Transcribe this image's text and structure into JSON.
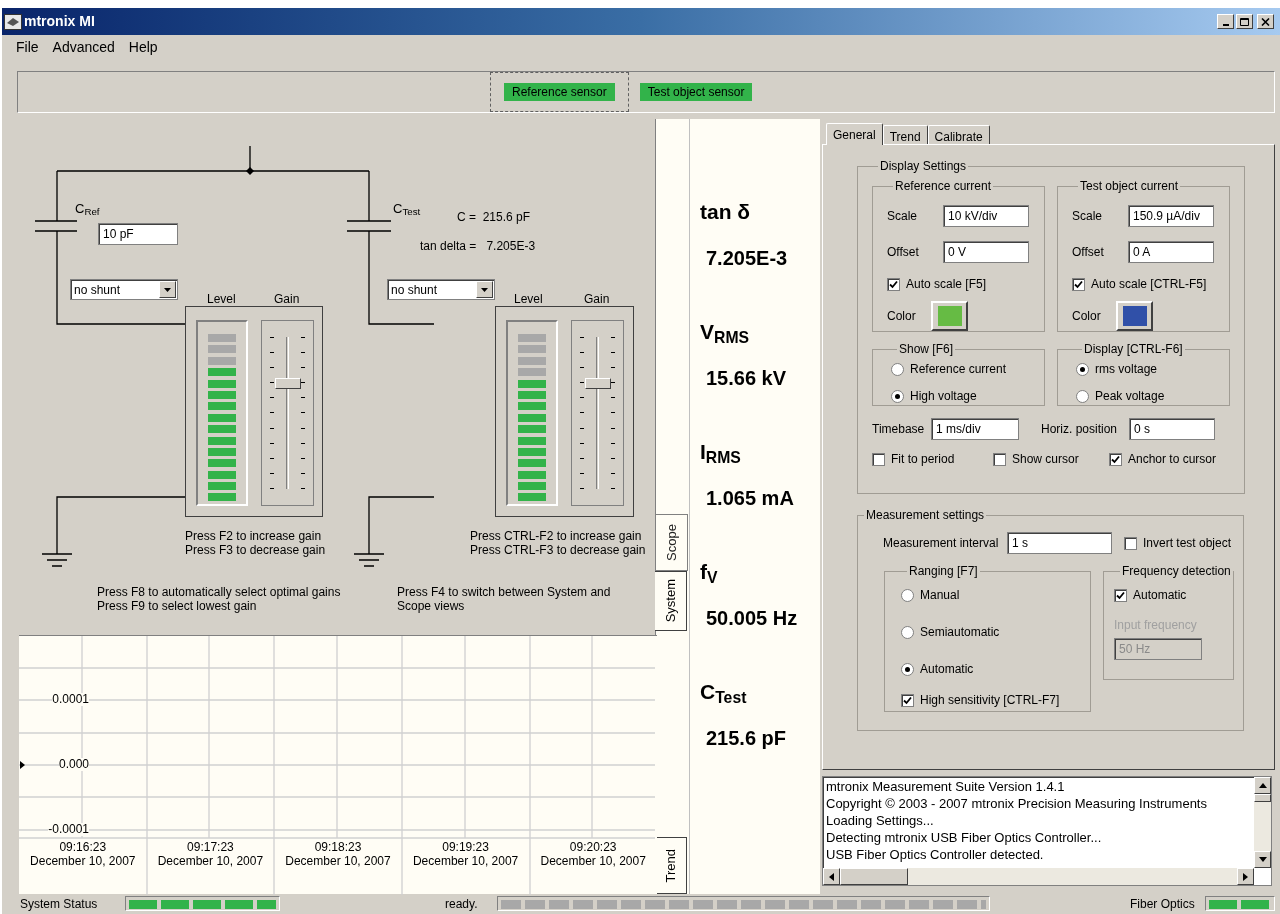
{
  "window": {
    "title": "mtronix MI"
  },
  "menu": [
    {
      "label": "File"
    },
    {
      "label": "Advanced"
    },
    {
      "label": "Help"
    }
  ],
  "sensors": [
    {
      "label": "Reference sensor",
      "focused": true
    },
    {
      "label": "Test object sensor",
      "focused": false
    }
  ],
  "circuit": {
    "branches": [
      {
        "capacitor": "C$_{Ref}$",
        "capacitance": "10 pF",
        "shunt": "no shunt",
        "level_label": "Level",
        "gain_label": "Gain",
        "meter": {
          "level": 0.8
        },
        "gain": {
          "level": 0.7
        },
        "hints": [
          "Press F2 to increase gain",
          "Press F3 to decrease gain"
        ]
      },
      {
        "capacitor": "C$_{Test}$",
        "readout": [
          "C =  215.6 pF",
          "tan delta =   7.205E-3"
        ],
        "shunt": "no shunt",
        "level_label": "Level",
        "gain_label": "Gain",
        "meter": {
          "level": 0.733
        },
        "gain": {
          "level": 0.7
        },
        "hints": [
          "Press CTRL-F2 to increase gain",
          "Press CTRL-F3 to decrease gain"
        ]
      }
    ],
    "notes": [
      [
        "Press F8 to automatically select optimal gains",
        "Press F9 to select lowest gain"
      ],
      [
        "Press F4 to switch between System and Scope views"
      ]
    ]
  },
  "view_tabs": [
    {
      "label": "Scope",
      "selected": false
    },
    {
      "label": "System",
      "selected": true
    }
  ],
  "readings": [
    {
      "label": "tan δ",
      "value": "7.205E-3"
    },
    {
      "label": "V$_{RMS}$",
      "value": "15.66 kV"
    },
    {
      "label": "I$_{RMS}$",
      "value": "1.065 mA"
    },
    {
      "label": "f$_{V}$",
      "value": "50.005 Hz"
    },
    {
      "label": "C$_{Test}$",
      "value": "215.6 pF"
    }
  ],
  "trend": {
    "tab": {
      "label": "Trend",
      "selected": true
    },
    "y_labels": [
      "0.0001",
      "0.000",
      "-0.0001"
    ],
    "x_labels": [
      {
        "time": "09:16:23",
        "date": "December 10, 2007"
      },
      {
        "time": "09:17:23",
        "date": "December 10, 2007"
      },
      {
        "time": "09:18:23",
        "date": "December 10, 2007"
      },
      {
        "time": "09:19:23",
        "date": "December 10, 2007"
      },
      {
        "time": "09:20:23",
        "date": "December 10, 2007"
      }
    ]
  },
  "settings": {
    "tabs": [
      {
        "label": "General",
        "selected": true
      },
      {
        "label": "Trend",
        "selected": false
      },
      {
        "label": "Calibrate",
        "selected": false
      }
    ],
    "display": {
      "title": "Display Settings",
      "channels": [
        {
          "title": "Reference current",
          "scale_label": "Scale",
          "scale": "10 kV/div",
          "offset_label": "Offset",
          "offset": "0 V",
          "auto_scale": {
            "label": "Auto scale [F5]",
            "checked": true
          },
          "color_label": "Color",
          "color": "#66bb44"
        },
        {
          "title": "Test object current",
          "scale_label": "Scale",
          "scale": "150.9 µA/div",
          "offset_label": "Offset",
          "offset": "0 A",
          "auto_scale": {
            "label": "Auto scale [CTRL-F5]",
            "checked": true
          },
          "color_label": "Color",
          "color": "#3050a8"
        }
      ],
      "choices": [
        {
          "title": "Show [F6]",
          "options": [
            {
              "label": "Reference current",
              "selected": false
            },
            {
              "label": "High voltage",
              "selected": true
            }
          ]
        },
        {
          "title": "Display [CTRL-F6]",
          "options": [
            {
              "label": "rms voltage",
              "selected": true
            },
            {
              "label": "Peak voltage",
              "selected": false
            }
          ]
        }
      ],
      "timebase": {
        "label": "Timebase",
        "value": "1 ms/div"
      },
      "horiz_position": {
        "label": "Horiz. position",
        "value": "0 s"
      },
      "options": [
        {
          "label": "Fit to period",
          "checked": false
        },
        {
          "label": "Show cursor",
          "checked": false
        },
        {
          "label": "Anchor to cursor",
          "checked": true
        }
      ]
    },
    "measurement": {
      "title": "Measurement settings",
      "interval": {
        "label": "Measurement interval",
        "value": "1 s"
      },
      "invert": {
        "label": "Invert test object",
        "checked": false
      },
      "ranging": {
        "title": "Ranging [F7]",
        "options": [
          {
            "label": "Manual",
            "selected": false
          },
          {
            "label": "Semiautomatic",
            "selected": false
          },
          {
            "label": "Automatic",
            "selected": true
          }
        ],
        "high_sensitivity": {
          "label": "High sensitivity [CTRL-F7]",
          "checked": true
        }
      },
      "frequency": {
        "title": "Frequency detection",
        "automatic": {
          "label": "Automatic",
          "checked": true
        },
        "input": {
          "label": "Input frequency",
          "value": "50 Hz",
          "disabled": true
        }
      }
    }
  },
  "log": {
    "lines": [
      "mtronix Measurement Suite Version 1.4.1",
      "Copyright © 2003 - 2007 mtronix Precision Measuring Instruments",
      "Loading Settings...",
      "Detecting mtronix USB Fiber Optics Controller...",
      "USB Fiber Optics Controller detected."
    ]
  },
  "status_bar": {
    "system": {
      "label": "System Status",
      "level": 1
    },
    "progress": {
      "text": "ready.",
      "level": 0
    },
    "fiber": {
      "label": "Fiber Optics",
      "level": 1
    }
  }
}
